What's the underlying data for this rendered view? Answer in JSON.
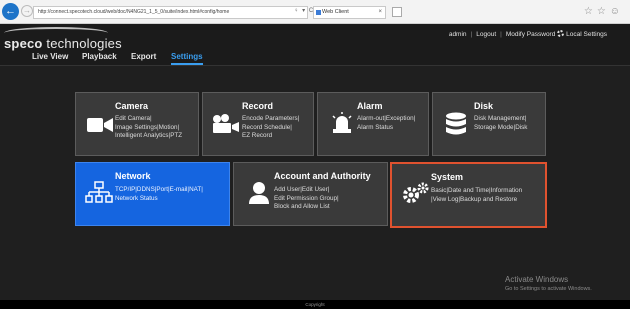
{
  "browser": {
    "url": "http://connect.specotech.cloud/web/doc/N4NG21_1_5_0/suite/index.html#config/home",
    "tab_title": "Web Client",
    "tab_close": "×",
    "back_glyph": "←",
    "forward_glyph": "→",
    "address_tools": "♀ ▾ C",
    "right_icons": "☆☆☺"
  },
  "app": {
    "logo_text_bold": "speco",
    "logo_text": " technologies",
    "nav": [
      "Live View",
      "Playback",
      "Export",
      "Settings"
    ],
    "active_nav": "Settings",
    "user": "admin",
    "logout": "Logout",
    "modify_password": "Modify Password",
    "local_settings": "Local Settings",
    "separator": "|"
  },
  "tiles": [
    {
      "id": "camera",
      "title": "Camera",
      "lines": [
        "Edit Camera|",
        "Image Settings|Motion|",
        "Intelligent Analytics|PTZ"
      ],
      "icon": "camera-icon"
    },
    {
      "id": "record",
      "title": "Record",
      "lines": [
        "Encode Parameters|",
        "Record Schedule|",
        "EZ Record"
      ],
      "icon": "record-icon"
    },
    {
      "id": "alarm",
      "title": "Alarm",
      "lines": [
        "Alarm-out|Exception|",
        "Alarm Status"
      ],
      "icon": "alarm-icon"
    },
    {
      "id": "disk",
      "title": "Disk",
      "lines": [
        "Disk Management|",
        "Storage Mode|Disk"
      ],
      "icon": "disk-icon"
    },
    {
      "id": "network",
      "title": "Network",
      "lines": [
        "TCP/IP|DDNS|Port|E-mail|NAT|",
        "Network Status"
      ],
      "icon": "network-icon"
    },
    {
      "id": "account",
      "title": "Account and Authority",
      "lines": [
        "Add User|Edit User|",
        "Edit Permission Group|",
        "Block and Allow List"
      ],
      "icon": "user-icon"
    },
    {
      "id": "system",
      "title": "System",
      "lines": [
        "Basic|Date and Time|Information",
        "|View Log|Backup and Restore"
      ],
      "icon": "gears-icon"
    }
  ],
  "colors": {
    "accent": "#1565e0",
    "selected_border": "#e0522f",
    "tile_bg": "#3a3a3a",
    "page_bg": "#1f1f1f"
  },
  "watermark": {
    "line1": "Activate Windows",
    "line2": "Go to Settings to activate Windows."
  },
  "footer": {
    "text": "Copyright"
  }
}
